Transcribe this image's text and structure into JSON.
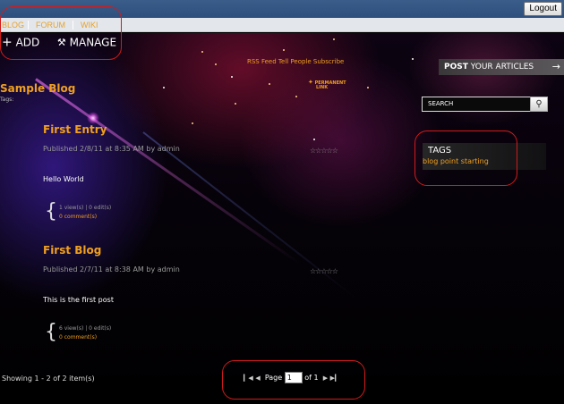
{
  "topbar": {
    "logout_label": "Logout"
  },
  "nav": {
    "items": [
      "BLOG",
      "FORUM",
      "WIKI"
    ]
  },
  "actions": {
    "add_label": "ADD",
    "manage_label": "MANAGE"
  },
  "header": {
    "rss_label": "RSS Feed",
    "tell_label": "Tell People",
    "subscribe_label": "Subscribe",
    "post_bold": "POST",
    "post_rest": "YOUR ARTICLES",
    "post_arrow": "→",
    "permalink_line1": "PERMANENT",
    "permalink_line2": "LINK"
  },
  "blog": {
    "title": "Sample Blog",
    "tags_label": "Tags:"
  },
  "search": {
    "placeholder": "SEARCH"
  },
  "tags_panel": {
    "title": "TAGS",
    "items": [
      "blog",
      "point",
      "starting"
    ]
  },
  "entries": [
    {
      "title": "First Entry",
      "meta": "Published 2/8/11 at 8:35 AM by admin",
      "stars": "☆☆☆☆☆",
      "body": "Hello World",
      "stats": "1 view(s) | 0 edit(s)",
      "comments": "0 comment(s)"
    },
    {
      "title": "First Blog",
      "meta": "Published 2/7/11 at 8:38 AM by admin",
      "stars": "☆☆☆☆☆",
      "body": "This is the first post",
      "stats": "6 view(s) | 0 edit(s)",
      "comments": "0 comment(s)"
    }
  ],
  "footer": {
    "showing": "Showing 1 - 2 of 2 item(s)"
  },
  "pager": {
    "page_label": "Page",
    "page_value": "1",
    "of_label": "of 1"
  },
  "icons": {
    "add": "plus-icon",
    "manage": "tools-icon",
    "search": "magnifier-icon",
    "pager_first": "first-page-icon",
    "pager_prev": "prev-page-icon",
    "pager_next": "next-page-icon",
    "pager_last": "last-page-icon"
  },
  "colors": {
    "accent": "#f0a020",
    "topbar": "#2d4f7e",
    "annotation": "#d21b1b"
  }
}
